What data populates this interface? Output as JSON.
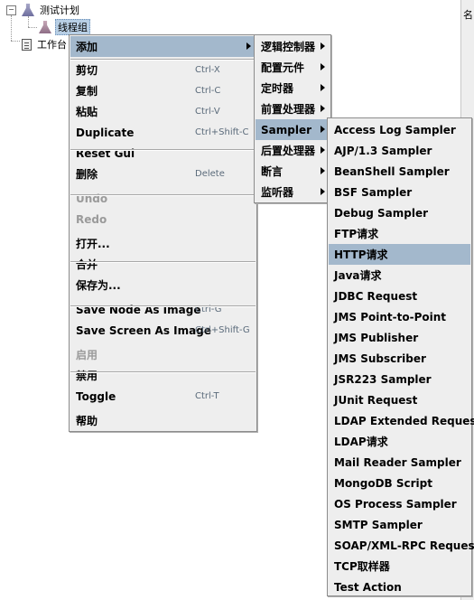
{
  "tree": {
    "root_label": "测试计划",
    "thread_group_label": "线程组",
    "workbench_label": "工作台"
  },
  "right_panel": {
    "label": "名"
  },
  "context_menu": {
    "items": [
      {
        "label": "添加",
        "shortcut": "",
        "disabled": false,
        "submenu": true,
        "highlighted": true
      },
      {
        "label": "剪切",
        "shortcut": "Ctrl-X",
        "disabled": false
      },
      {
        "label": "复制",
        "shortcut": "Ctrl-C",
        "disabled": false
      },
      {
        "label": "粘贴",
        "shortcut": "Ctrl-V",
        "disabled": false
      },
      {
        "label": "Duplicate",
        "shortcut": "Ctrl+Shift-C",
        "disabled": false
      },
      {
        "label": "Reset Gui",
        "shortcut": "",
        "disabled": false
      },
      {
        "label": "删除",
        "shortcut": "Delete",
        "disabled": false
      },
      {
        "label": "Undo",
        "shortcut": "",
        "disabled": true
      },
      {
        "label": "Redo",
        "shortcut": "",
        "disabled": true
      },
      {
        "label": "打开...",
        "shortcut": "",
        "disabled": false
      },
      {
        "label": "合并",
        "shortcut": "",
        "disabled": false
      },
      {
        "label": "保存为...",
        "shortcut": "",
        "disabled": false
      },
      {
        "label": "Save Node As Image",
        "shortcut": "Ctrl-G",
        "disabled": false
      },
      {
        "label": "Save Screen As Image",
        "shortcut": "Ctrl+Shift-G",
        "disabled": false
      },
      {
        "label": "启用",
        "shortcut": "",
        "disabled": true
      },
      {
        "label": "禁用",
        "shortcut": "",
        "disabled": false
      },
      {
        "label": "Toggle",
        "shortcut": "Ctrl-T",
        "disabled": false
      },
      {
        "label": "帮助",
        "shortcut": "",
        "disabled": false
      }
    ]
  },
  "add_submenu": {
    "items": [
      {
        "label": "逻辑控制器"
      },
      {
        "label": "配置元件"
      },
      {
        "label": "定时器"
      },
      {
        "label": "前置处理器"
      },
      {
        "label": "Sampler",
        "highlighted": true
      },
      {
        "label": "后置处理器"
      },
      {
        "label": "断言"
      },
      {
        "label": "监听器"
      }
    ]
  },
  "sampler_submenu": {
    "items": [
      {
        "label": "Access Log Sampler"
      },
      {
        "label": "AJP/1.3 Sampler"
      },
      {
        "label": "BeanShell Sampler"
      },
      {
        "label": "BSF Sampler"
      },
      {
        "label": "Debug Sampler"
      },
      {
        "label": "FTP请求"
      },
      {
        "label": "HTTP请求",
        "highlighted": true
      },
      {
        "label": "Java请求"
      },
      {
        "label": "JDBC Request"
      },
      {
        "label": "JMS Point-to-Point"
      },
      {
        "label": "JMS Publisher"
      },
      {
        "label": "JMS Subscriber"
      },
      {
        "label": "JSR223 Sampler"
      },
      {
        "label": "JUnit Request"
      },
      {
        "label": "LDAP Extended Request"
      },
      {
        "label": "LDAP请求"
      },
      {
        "label": "Mail Reader Sampler"
      },
      {
        "label": "MongoDB Script"
      },
      {
        "label": "OS Process Sampler"
      },
      {
        "label": "SMTP Sampler"
      },
      {
        "label": "SOAP/XML-RPC Request"
      },
      {
        "label": "TCP取样器"
      },
      {
        "label": "Test Action"
      }
    ]
  }
}
